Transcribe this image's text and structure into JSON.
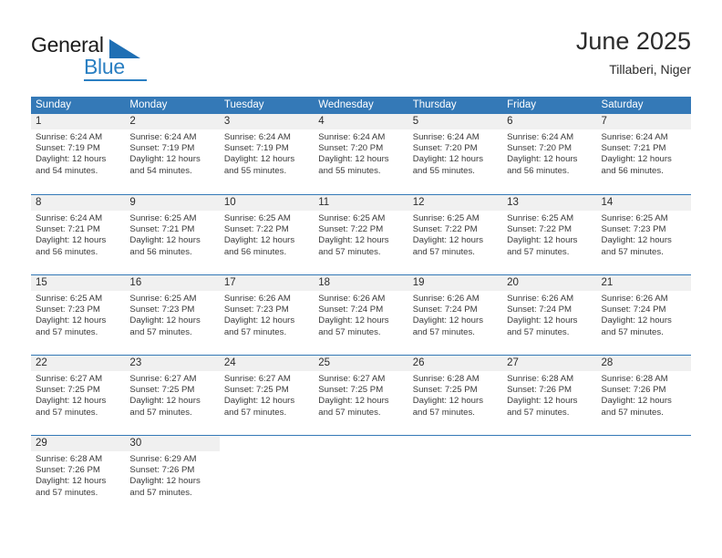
{
  "brand": {
    "word_one": "General",
    "word_two": "Blue",
    "triangle_color": "#1f6fb4",
    "blue_color": "#2a7fc2"
  },
  "header": {
    "title": "June 2025",
    "subtitle": "Tillaberi, Niger"
  },
  "theme": {
    "header_bg": "#3479b7",
    "header_text": "#ffffff",
    "day_band_bg": "#f0f0f0",
    "grid_line": "#3479b7",
    "body_text": "#3a3a3a"
  },
  "calendar": {
    "weekdays": [
      "Sunday",
      "Monday",
      "Tuesday",
      "Wednesday",
      "Thursday",
      "Friday",
      "Saturday"
    ],
    "weeks": [
      [
        {
          "day": "1",
          "sunrise": "Sunrise: 6:24 AM",
          "sunset": "Sunset: 7:19 PM",
          "daylight1": "Daylight: 12 hours",
          "daylight2": "and 54 minutes."
        },
        {
          "day": "2",
          "sunrise": "Sunrise: 6:24 AM",
          "sunset": "Sunset: 7:19 PM",
          "daylight1": "Daylight: 12 hours",
          "daylight2": "and 54 minutes."
        },
        {
          "day": "3",
          "sunrise": "Sunrise: 6:24 AM",
          "sunset": "Sunset: 7:19 PM",
          "daylight1": "Daylight: 12 hours",
          "daylight2": "and 55 minutes."
        },
        {
          "day": "4",
          "sunrise": "Sunrise: 6:24 AM",
          "sunset": "Sunset: 7:20 PM",
          "daylight1": "Daylight: 12 hours",
          "daylight2": "and 55 minutes."
        },
        {
          "day": "5",
          "sunrise": "Sunrise: 6:24 AM",
          "sunset": "Sunset: 7:20 PM",
          "daylight1": "Daylight: 12 hours",
          "daylight2": "and 55 minutes."
        },
        {
          "day": "6",
          "sunrise": "Sunrise: 6:24 AM",
          "sunset": "Sunset: 7:20 PM",
          "daylight1": "Daylight: 12 hours",
          "daylight2": "and 56 minutes."
        },
        {
          "day": "7",
          "sunrise": "Sunrise: 6:24 AM",
          "sunset": "Sunset: 7:21 PM",
          "daylight1": "Daylight: 12 hours",
          "daylight2": "and 56 minutes."
        }
      ],
      [
        {
          "day": "8",
          "sunrise": "Sunrise: 6:24 AM",
          "sunset": "Sunset: 7:21 PM",
          "daylight1": "Daylight: 12 hours",
          "daylight2": "and 56 minutes."
        },
        {
          "day": "9",
          "sunrise": "Sunrise: 6:25 AM",
          "sunset": "Sunset: 7:21 PM",
          "daylight1": "Daylight: 12 hours",
          "daylight2": "and 56 minutes."
        },
        {
          "day": "10",
          "sunrise": "Sunrise: 6:25 AM",
          "sunset": "Sunset: 7:22 PM",
          "daylight1": "Daylight: 12 hours",
          "daylight2": "and 56 minutes."
        },
        {
          "day": "11",
          "sunrise": "Sunrise: 6:25 AM",
          "sunset": "Sunset: 7:22 PM",
          "daylight1": "Daylight: 12 hours",
          "daylight2": "and 57 minutes."
        },
        {
          "day": "12",
          "sunrise": "Sunrise: 6:25 AM",
          "sunset": "Sunset: 7:22 PM",
          "daylight1": "Daylight: 12 hours",
          "daylight2": "and 57 minutes."
        },
        {
          "day": "13",
          "sunrise": "Sunrise: 6:25 AM",
          "sunset": "Sunset: 7:22 PM",
          "daylight1": "Daylight: 12 hours",
          "daylight2": "and 57 minutes."
        },
        {
          "day": "14",
          "sunrise": "Sunrise: 6:25 AM",
          "sunset": "Sunset: 7:23 PM",
          "daylight1": "Daylight: 12 hours",
          "daylight2": "and 57 minutes."
        }
      ],
      [
        {
          "day": "15",
          "sunrise": "Sunrise: 6:25 AM",
          "sunset": "Sunset: 7:23 PM",
          "daylight1": "Daylight: 12 hours",
          "daylight2": "and 57 minutes."
        },
        {
          "day": "16",
          "sunrise": "Sunrise: 6:25 AM",
          "sunset": "Sunset: 7:23 PM",
          "daylight1": "Daylight: 12 hours",
          "daylight2": "and 57 minutes."
        },
        {
          "day": "17",
          "sunrise": "Sunrise: 6:26 AM",
          "sunset": "Sunset: 7:23 PM",
          "daylight1": "Daylight: 12 hours",
          "daylight2": "and 57 minutes."
        },
        {
          "day": "18",
          "sunrise": "Sunrise: 6:26 AM",
          "sunset": "Sunset: 7:24 PM",
          "daylight1": "Daylight: 12 hours",
          "daylight2": "and 57 minutes."
        },
        {
          "day": "19",
          "sunrise": "Sunrise: 6:26 AM",
          "sunset": "Sunset: 7:24 PM",
          "daylight1": "Daylight: 12 hours",
          "daylight2": "and 57 minutes."
        },
        {
          "day": "20",
          "sunrise": "Sunrise: 6:26 AM",
          "sunset": "Sunset: 7:24 PM",
          "daylight1": "Daylight: 12 hours",
          "daylight2": "and 57 minutes."
        },
        {
          "day": "21",
          "sunrise": "Sunrise: 6:26 AM",
          "sunset": "Sunset: 7:24 PM",
          "daylight1": "Daylight: 12 hours",
          "daylight2": "and 57 minutes."
        }
      ],
      [
        {
          "day": "22",
          "sunrise": "Sunrise: 6:27 AM",
          "sunset": "Sunset: 7:25 PM",
          "daylight1": "Daylight: 12 hours",
          "daylight2": "and 57 minutes."
        },
        {
          "day": "23",
          "sunrise": "Sunrise: 6:27 AM",
          "sunset": "Sunset: 7:25 PM",
          "daylight1": "Daylight: 12 hours",
          "daylight2": "and 57 minutes."
        },
        {
          "day": "24",
          "sunrise": "Sunrise: 6:27 AM",
          "sunset": "Sunset: 7:25 PM",
          "daylight1": "Daylight: 12 hours",
          "daylight2": "and 57 minutes."
        },
        {
          "day": "25",
          "sunrise": "Sunrise: 6:27 AM",
          "sunset": "Sunset: 7:25 PM",
          "daylight1": "Daylight: 12 hours",
          "daylight2": "and 57 minutes."
        },
        {
          "day": "26",
          "sunrise": "Sunrise: 6:28 AM",
          "sunset": "Sunset: 7:25 PM",
          "daylight1": "Daylight: 12 hours",
          "daylight2": "and 57 minutes."
        },
        {
          "day": "27",
          "sunrise": "Sunrise: 6:28 AM",
          "sunset": "Sunset: 7:26 PM",
          "daylight1": "Daylight: 12 hours",
          "daylight2": "and 57 minutes."
        },
        {
          "day": "28",
          "sunrise": "Sunrise: 6:28 AM",
          "sunset": "Sunset: 7:26 PM",
          "daylight1": "Daylight: 12 hours",
          "daylight2": "and 57 minutes."
        }
      ],
      [
        {
          "day": "29",
          "sunrise": "Sunrise: 6:28 AM",
          "sunset": "Sunset: 7:26 PM",
          "daylight1": "Daylight: 12 hours",
          "daylight2": "and 57 minutes."
        },
        {
          "day": "30",
          "sunrise": "Sunrise: 6:29 AM",
          "sunset": "Sunset: 7:26 PM",
          "daylight1": "Daylight: 12 hours",
          "daylight2": "and 57 minutes."
        },
        {
          "day": "",
          "sunrise": "",
          "sunset": "",
          "daylight1": "",
          "daylight2": ""
        },
        {
          "day": "",
          "sunrise": "",
          "sunset": "",
          "daylight1": "",
          "daylight2": ""
        },
        {
          "day": "",
          "sunrise": "",
          "sunset": "",
          "daylight1": "",
          "daylight2": ""
        },
        {
          "day": "",
          "sunrise": "",
          "sunset": "",
          "daylight1": "",
          "daylight2": ""
        },
        {
          "day": "",
          "sunrise": "",
          "sunset": "",
          "daylight1": "",
          "daylight2": ""
        }
      ]
    ]
  }
}
